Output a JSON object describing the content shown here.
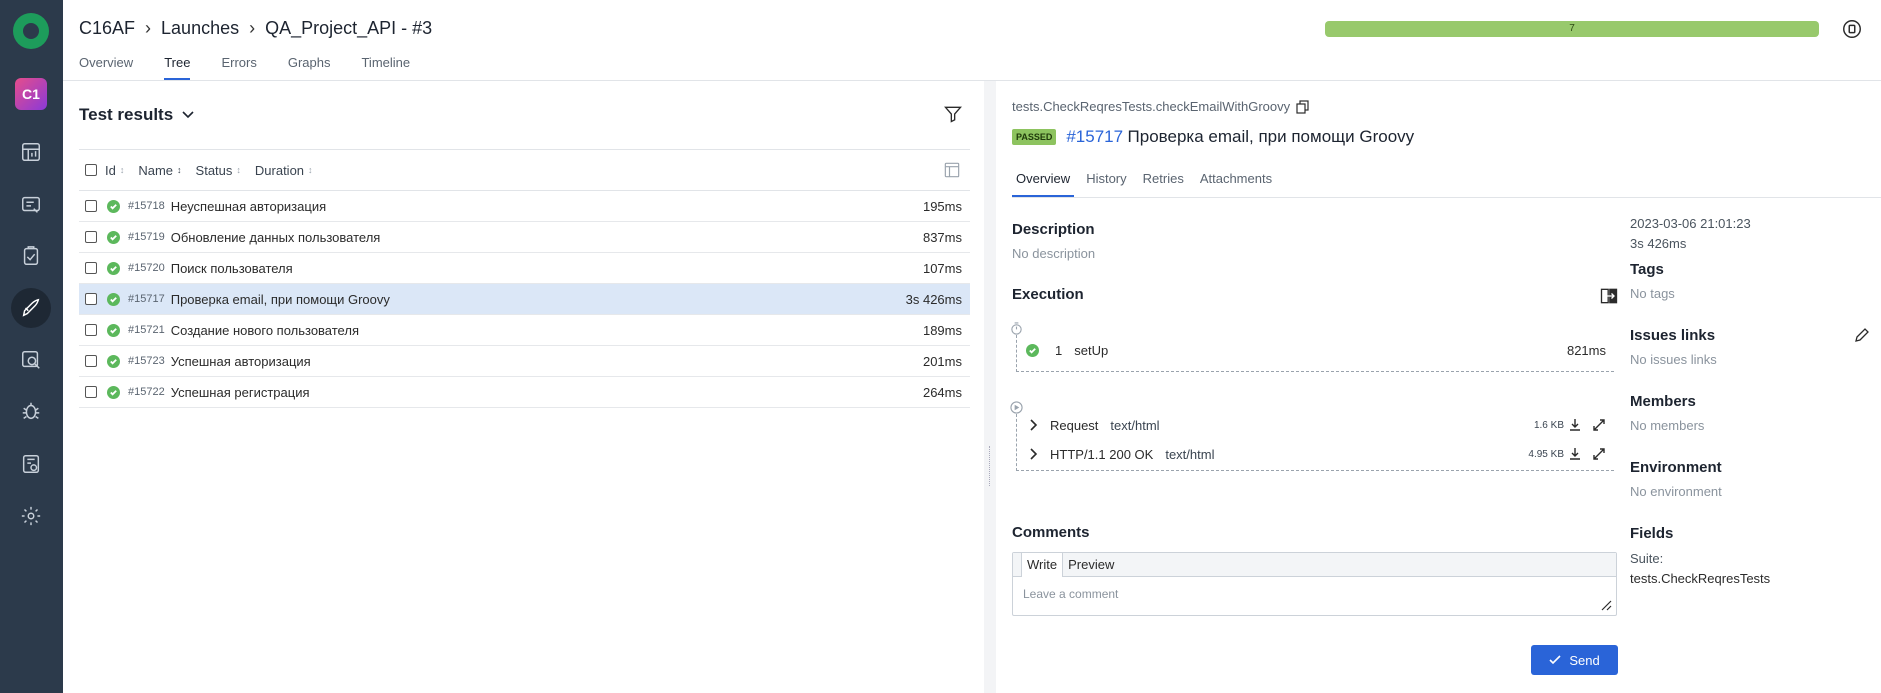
{
  "nav": {
    "logo_icon": "allure-logo-icon",
    "project_badge": "C1",
    "items": [
      "dashboard-icon",
      "test-cases-icon",
      "test-plans-icon",
      "launches-icon",
      "analytics-icon",
      "defects-icon",
      "jobs-icon",
      "settings-icon"
    ]
  },
  "header": {
    "breadcrumb": [
      "C16AF",
      "Launches",
      "QA_Project_API - #3"
    ],
    "tabs": [
      "Overview",
      "Tree",
      "Errors",
      "Graphs",
      "Timeline"
    ],
    "active_tab": "Tree",
    "progress_label": "7",
    "progress_color": "#98c96c"
  },
  "left": {
    "title": "Test results",
    "columns": [
      "Id",
      "Name",
      "Status",
      "Duration"
    ],
    "rows": [
      {
        "id": "#15718",
        "name": "Неуспешная авторизация",
        "duration": "195ms"
      },
      {
        "id": "#15719",
        "name": "Обновление данных пользователя",
        "duration": "837ms"
      },
      {
        "id": "#15720",
        "name": "Поиск пользователя",
        "duration": "107ms"
      },
      {
        "id": "#15717",
        "name": "Проверка email, при помощи Groovy",
        "duration": "3s 426ms"
      },
      {
        "id": "#15721",
        "name": "Создание нового пользователя",
        "duration": "189ms"
      },
      {
        "id": "#15723",
        "name": "Успешная авторизация",
        "duration": "201ms"
      },
      {
        "id": "#15722",
        "name": "Успешная регистрация",
        "duration": "264ms"
      }
    ]
  },
  "detail": {
    "full_name": "tests.CheckReqresTests.checkEmailWithGroovy",
    "status_badge": "PASSED",
    "id": "#15717",
    "name": "Проверка email, при помощи Groovy",
    "tabs": [
      "Overview",
      "History",
      "Retries",
      "Attachments"
    ],
    "description_title": "Description",
    "description_value": "No description",
    "execution_title": "Execution",
    "setup_step": {
      "num": "1",
      "name": "setUp",
      "duration": "821ms"
    },
    "attachments": [
      {
        "name": "Request",
        "mime": "text/html",
        "size": "1.6 KB"
      },
      {
        "name": "HTTP/1.1 200 OK",
        "mime": "text/html",
        "size": "4.95 KB"
      }
    ],
    "comments_title": "Comments",
    "comment_tabs": [
      "Write",
      "Preview"
    ],
    "comment_placeholder": "Leave a comment",
    "send_label": "Send"
  },
  "side": {
    "date": "2023-03-06 21:01:23",
    "duration": "3s 426ms",
    "tags_title": "Tags",
    "tags_value": "No tags",
    "issues_title": "Issues links",
    "issues_value": "No issues links",
    "members_title": "Members",
    "members_value": "No members",
    "env_title": "Environment",
    "env_value": "No environment",
    "fields_title": "Fields",
    "suite_label": "Suite:",
    "suite_value": "tests.CheckReqresTests"
  }
}
